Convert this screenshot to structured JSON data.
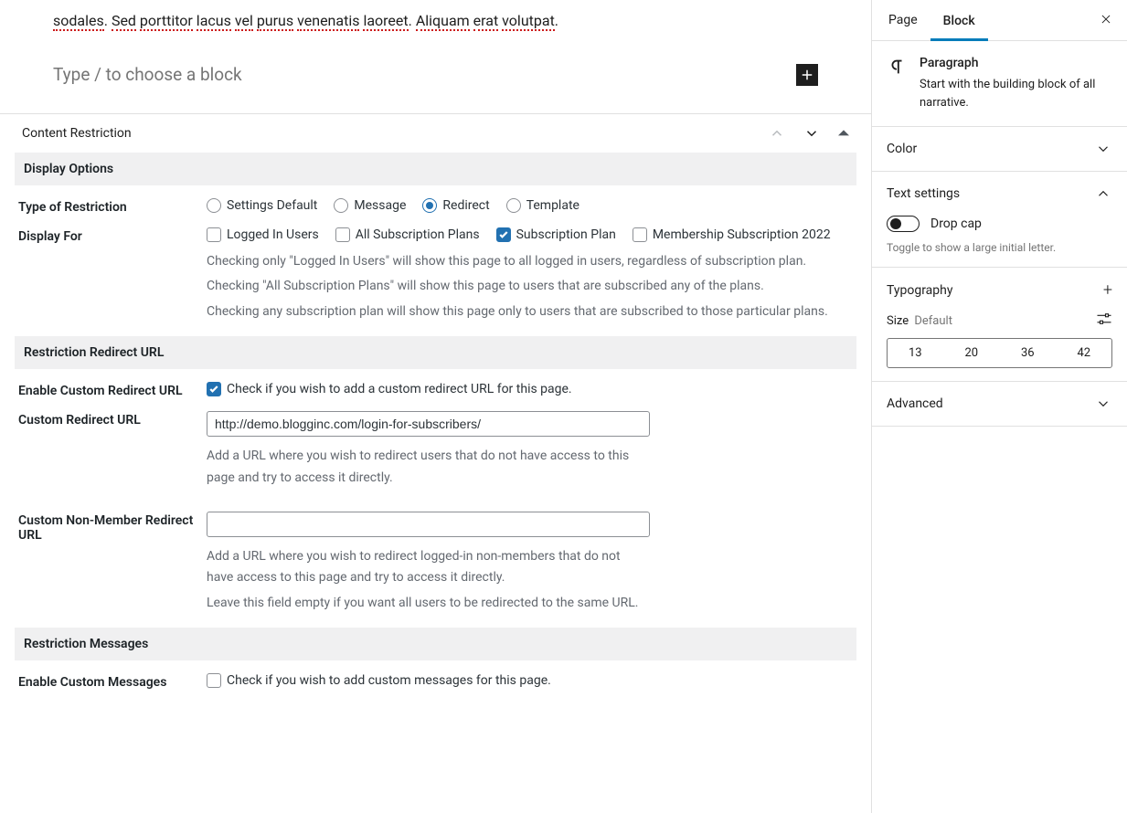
{
  "editor": {
    "body_text_parts": [
      "sodales",
      ". ",
      "Sed",
      " ",
      "porttitor",
      " ",
      "lacus",
      " ",
      "vel",
      " ",
      "purus",
      " ",
      "venenatis",
      " ",
      "laoreet",
      ". ",
      "Aliquam",
      " ",
      "erat",
      " ",
      "volutpat",
      "."
    ],
    "placeholder": "Type / to choose a block"
  },
  "metabox": {
    "title": "Content Restriction",
    "sections": {
      "display_options": "Display Options",
      "restriction_redirect": "Restriction Redirect URL",
      "restriction_messages": "Restriction Messages"
    },
    "type_of_restriction": {
      "label": "Type of Restriction",
      "options": [
        "Settings Default",
        "Message",
        "Redirect",
        "Template"
      ],
      "selected_index": 2
    },
    "display_for": {
      "label": "Display For",
      "options": [
        "Logged In Users",
        "All Subscription Plans",
        "Subscription Plan",
        "Membership Subscription 2022"
      ],
      "checked_indexes": [
        2
      ],
      "help_1": "Checking only \"Logged In Users\" will show this page to all logged in users, regardless of subscription plan.",
      "help_2": "Checking \"All Subscription Plans\" will show this page to users that are subscribed any of the plans.",
      "help_3": "Checking any subscription plan will show this page only to users that are subscribed to those particular plans."
    },
    "enable_custom_redirect": {
      "label": "Enable Custom Redirect URL",
      "checkbox_label": "Check if you wish to add a custom redirect URL for this page.",
      "checked": true
    },
    "custom_redirect": {
      "label": "Custom Redirect URL",
      "value": "http://demo.blogginc.com/login-for-subscribers/",
      "help": "Add a URL where you wish to redirect users that do not have access to this page and try to access it directly."
    },
    "custom_nonmember": {
      "label": "Custom Non-Member Redirect URL",
      "value": "",
      "help_1": "Add a URL where you wish to redirect logged-in non-members that do not have access to this page and try to access it directly.",
      "help_2": "Leave this field empty if you want all users to be redirected to the same URL."
    },
    "enable_custom_messages": {
      "label": "Enable Custom Messages",
      "checkbox_label": "Check if you wish to add custom messages for this page.",
      "checked": false
    }
  },
  "sidebar": {
    "tabs": {
      "page": "Page",
      "block": "Block"
    },
    "block_header": {
      "title": "Paragraph",
      "desc": "Start with the building block of all narrative."
    },
    "sections": {
      "color": "Color",
      "text_settings": "Text settings",
      "typography": "Typography",
      "advanced": "Advanced"
    },
    "drop_cap": {
      "label": "Drop cap",
      "help": "Toggle to show a large initial letter."
    },
    "size": {
      "label": "Size",
      "default_text": "Default",
      "options": [
        "13",
        "20",
        "36",
        "42"
      ]
    }
  }
}
